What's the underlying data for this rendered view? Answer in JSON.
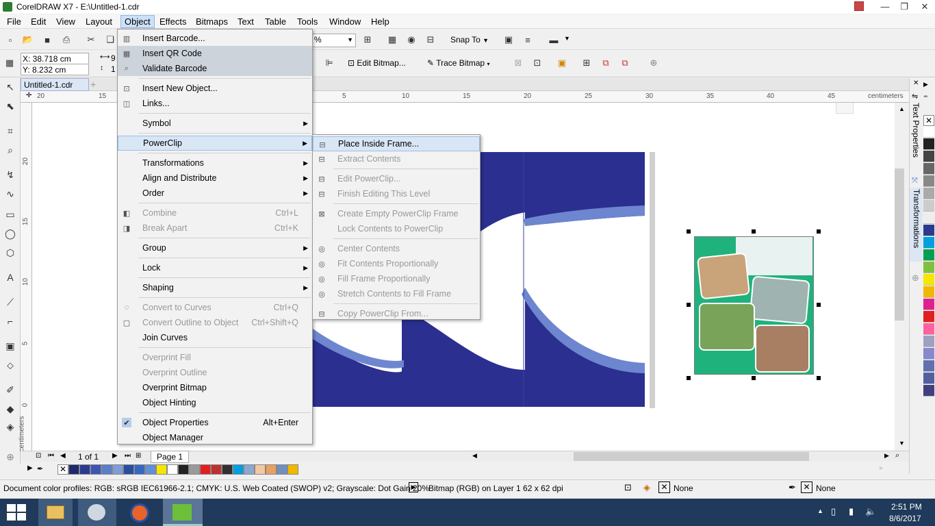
{
  "app": {
    "title": "CorelDRAW X7 - E:\\Untitled-1.cdr"
  },
  "menubar": [
    "File",
    "Edit",
    "View",
    "Layout",
    "Object",
    "Effects",
    "Bitmaps",
    "Text",
    "Table",
    "Tools",
    "Window",
    "Help"
  ],
  "toolbar": {
    "zoom": "%",
    "snap": "Snap To",
    "edit_bitmap": "Edit Bitmap...",
    "trace_bitmap": "Trace Bitmap"
  },
  "propbar": {
    "x": "X: 38.718 cm",
    "y": "Y: 8.232 cm",
    "w": "9",
    "h": "1"
  },
  "doc": {
    "tab": "Untitled-1.cdr"
  },
  "ruler": {
    "h": [
      "20",
      "15",
      "5",
      "10",
      "15",
      "20",
      "25",
      "30",
      "35",
      "40",
      "45"
    ],
    "unit": "centimeters",
    "v": [
      "20",
      "15",
      "10",
      "5",
      "0"
    ],
    "vunit": "centimeters"
  },
  "page_nav": {
    "of": "1 of 1",
    "page": "Page 1"
  },
  "object_menu": [
    {
      "label": "Insert Barcode...",
      "icon": "barcode-icon"
    },
    {
      "label": "Insert QR Code",
      "icon": "qr-icon",
      "state": "hl"
    },
    {
      "label": "Validate Barcode",
      "icon": "validate-icon",
      "state": "hl"
    },
    {
      "sep": true
    },
    {
      "label": "Insert New Object...",
      "icon": "new-object-icon"
    },
    {
      "label": "Links...",
      "icon": "ole-icon"
    },
    {
      "sep": true
    },
    {
      "label": "Symbol",
      "arrow": true
    },
    {
      "sep": true
    },
    {
      "label": "PowerClip",
      "arrow": true,
      "state": "open"
    },
    {
      "sep": true
    },
    {
      "label": "Transformations",
      "arrow": true
    },
    {
      "label": "Align and Distribute",
      "arrow": true
    },
    {
      "label": "Order",
      "arrow": true
    },
    {
      "sep": true
    },
    {
      "label": "Combine",
      "shortcut": "Ctrl+L",
      "icon": "combine-icon",
      "state": "dis"
    },
    {
      "label": "Break Apart",
      "shortcut": "Ctrl+K",
      "icon": "break-apart-icon",
      "state": "dis"
    },
    {
      "sep": true
    },
    {
      "label": "Group",
      "arrow": true
    },
    {
      "sep": true
    },
    {
      "label": "Lock",
      "arrow": true
    },
    {
      "sep": true
    },
    {
      "label": "Shaping",
      "arrow": true
    },
    {
      "sep": true
    },
    {
      "label": "Convert to Curves",
      "shortcut": "Ctrl+Q",
      "icon": "curves-icon",
      "state": "dis"
    },
    {
      "label": "Convert Outline to Object",
      "shortcut": "Ctrl+Shift+Q",
      "icon": "outline-icon",
      "state": "dis"
    },
    {
      "label": "Join Curves"
    },
    {
      "sep": true
    },
    {
      "label": "Overprint Fill",
      "state": "dis"
    },
    {
      "label": "Overprint Outline",
      "state": "dis"
    },
    {
      "label": "Overprint Bitmap"
    },
    {
      "label": "Object Hinting"
    },
    {
      "sep": true
    },
    {
      "label": "Object Properties",
      "shortcut": "Alt+Enter",
      "icon": "check-icon"
    },
    {
      "label": "Object Manager"
    }
  ],
  "powerclip_menu": [
    {
      "label": "Place Inside Frame...",
      "icon": "place-frame-icon",
      "state": "open"
    },
    {
      "label": "Extract Contents",
      "icon": "extract-icon",
      "state": "dis"
    },
    {
      "sep": true
    },
    {
      "label": "Edit PowerClip...",
      "icon": "edit-pc-icon",
      "state": "dis"
    },
    {
      "label": "Finish Editing This Level",
      "icon": "finish-icon",
      "state": "dis"
    },
    {
      "sep": true
    },
    {
      "label": "Create Empty PowerClip Frame",
      "icon": "empty-frame-icon",
      "state": "dis"
    },
    {
      "label": "Lock Contents to PowerClip",
      "state": "dis"
    },
    {
      "sep": true
    },
    {
      "label": "Center Contents",
      "icon": "center-icon",
      "state": "dis"
    },
    {
      "label": "Fit Contents Proportionally",
      "icon": "fit-icon",
      "state": "dis"
    },
    {
      "label": "Fill Frame Proportionally",
      "icon": "fill-icon",
      "state": "dis"
    },
    {
      "label": "Stretch Contents to Fill Frame",
      "icon": "stretch-icon",
      "state": "dis"
    },
    {
      "sep": true
    },
    {
      "label": "Copy PowerClip From...",
      "icon": "copy-pc-icon",
      "state": "dis"
    }
  ],
  "dockers": [
    "Text Properties",
    "Transformations"
  ],
  "status": {
    "profiles": "Document color profiles: RGB: sRGB IEC61966-2.1; CMYK: U.S. Web Coated (SWOP) v2; Grayscale: Dot Gain 20%",
    "selection": "Bitmap (RGB) on Layer 1 62 x 62 dpi",
    "fill": "None",
    "outline": "None"
  },
  "clock": {
    "time": "2:51 PM",
    "date": "8/6/2017"
  },
  "palette": [
    "#1f2a6e",
    "#2b3a8f",
    "#3d55b5",
    "#5b7ec9",
    "#7e9dd8",
    "#2a4fa0",
    "#3866c2",
    "#5f8fd6",
    "#f7e600",
    "#ffffff",
    "#222222",
    "#9a9a9a",
    "#e02020",
    "#c03030",
    "#303030",
    "#00a0e0",
    "#8aa8d0",
    "#f3c8a0",
    "#e8a060",
    "#7090c0",
    "#f0b800"
  ],
  "rpalette": [
    "#ffffff",
    "#222222",
    "#444444",
    "#666666",
    "#888888",
    "#aaaaaa",
    "#cccccc",
    "#eeeeee",
    "#2b3a8f",
    "#00a0e0",
    "#00a050",
    "#80c040",
    "#f7e600",
    "#f0b800",
    "#e02090",
    "#e02020",
    "#ff60a0",
    "#a0a0c0",
    "#8888cc",
    "#6070b0",
    "#5060a0",
    "#404080"
  ]
}
